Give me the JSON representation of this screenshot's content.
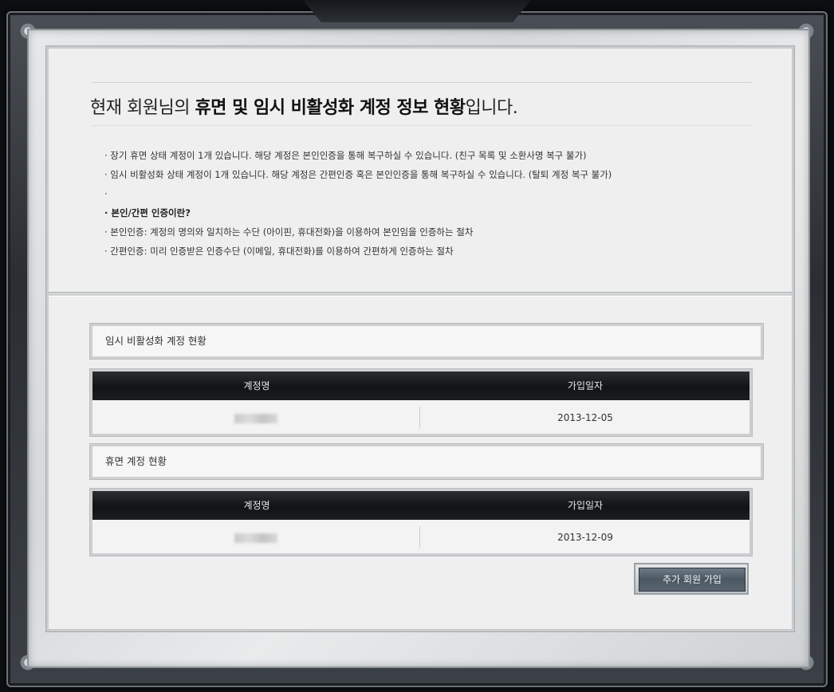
{
  "headline": {
    "prefix": "현재 회원님의 ",
    "bold": "휴면 및 임시 비활성화 계정 정보 현황",
    "suffix": "입니다."
  },
  "info_items": [
    "· 장기 휴면 상태 계정이 1개 있습니다. 해당 계정은 본인인증을 통해 복구하실 수 있습니다. (친구 목록 및 소환사명 복구 불가)",
    "· 임시 비활성화 상태 계정이 1개 있습니다. 해당 계정은 간편인증 혹은 본인인증을 통해 복구하실 수 있습니다. (탈퇴 계정 복구 불가)",
    "·",
    "· 본인/간편 인증이란?",
    "· 본인인증: 계정의 명의와 일치하는 수단 (아이핀, 휴대전화)을 이용하여 본인임을 인증하는 절차",
    "· 간편인증: 미리 인증받은 인증수단 (이메일, 휴대전화)를 이용하여 간편하게 인증하는 절차"
  ],
  "inactive_section": {
    "title": "임시 비활성화 계정 현황",
    "columns": [
      "계정명",
      "가입일자"
    ],
    "rows": [
      {
        "account": "",
        "date": "2013-12-05"
      }
    ]
  },
  "dormant_section": {
    "title": "휴면 계정 현황",
    "columns": [
      "계정명",
      "가입일자"
    ],
    "rows": [
      {
        "account": "",
        "date": "2013-12-09"
      }
    ]
  },
  "signup_button": "추가 회원 가입"
}
